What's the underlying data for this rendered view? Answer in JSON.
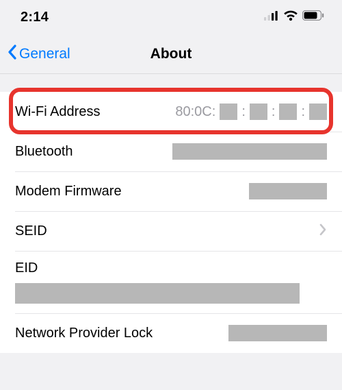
{
  "status_bar": {
    "time": "2:14"
  },
  "nav": {
    "back_label": "General",
    "title": "About"
  },
  "rows": {
    "wifi": {
      "label": "Wi-Fi Address",
      "prefix": "80:0C:"
    },
    "bluetooth": {
      "label": "Bluetooth"
    },
    "modem": {
      "label": "Modem Firmware"
    },
    "seid": {
      "label": "SEID"
    },
    "eid": {
      "label": "EID"
    },
    "npl": {
      "label": "Network Provider Lock"
    }
  }
}
